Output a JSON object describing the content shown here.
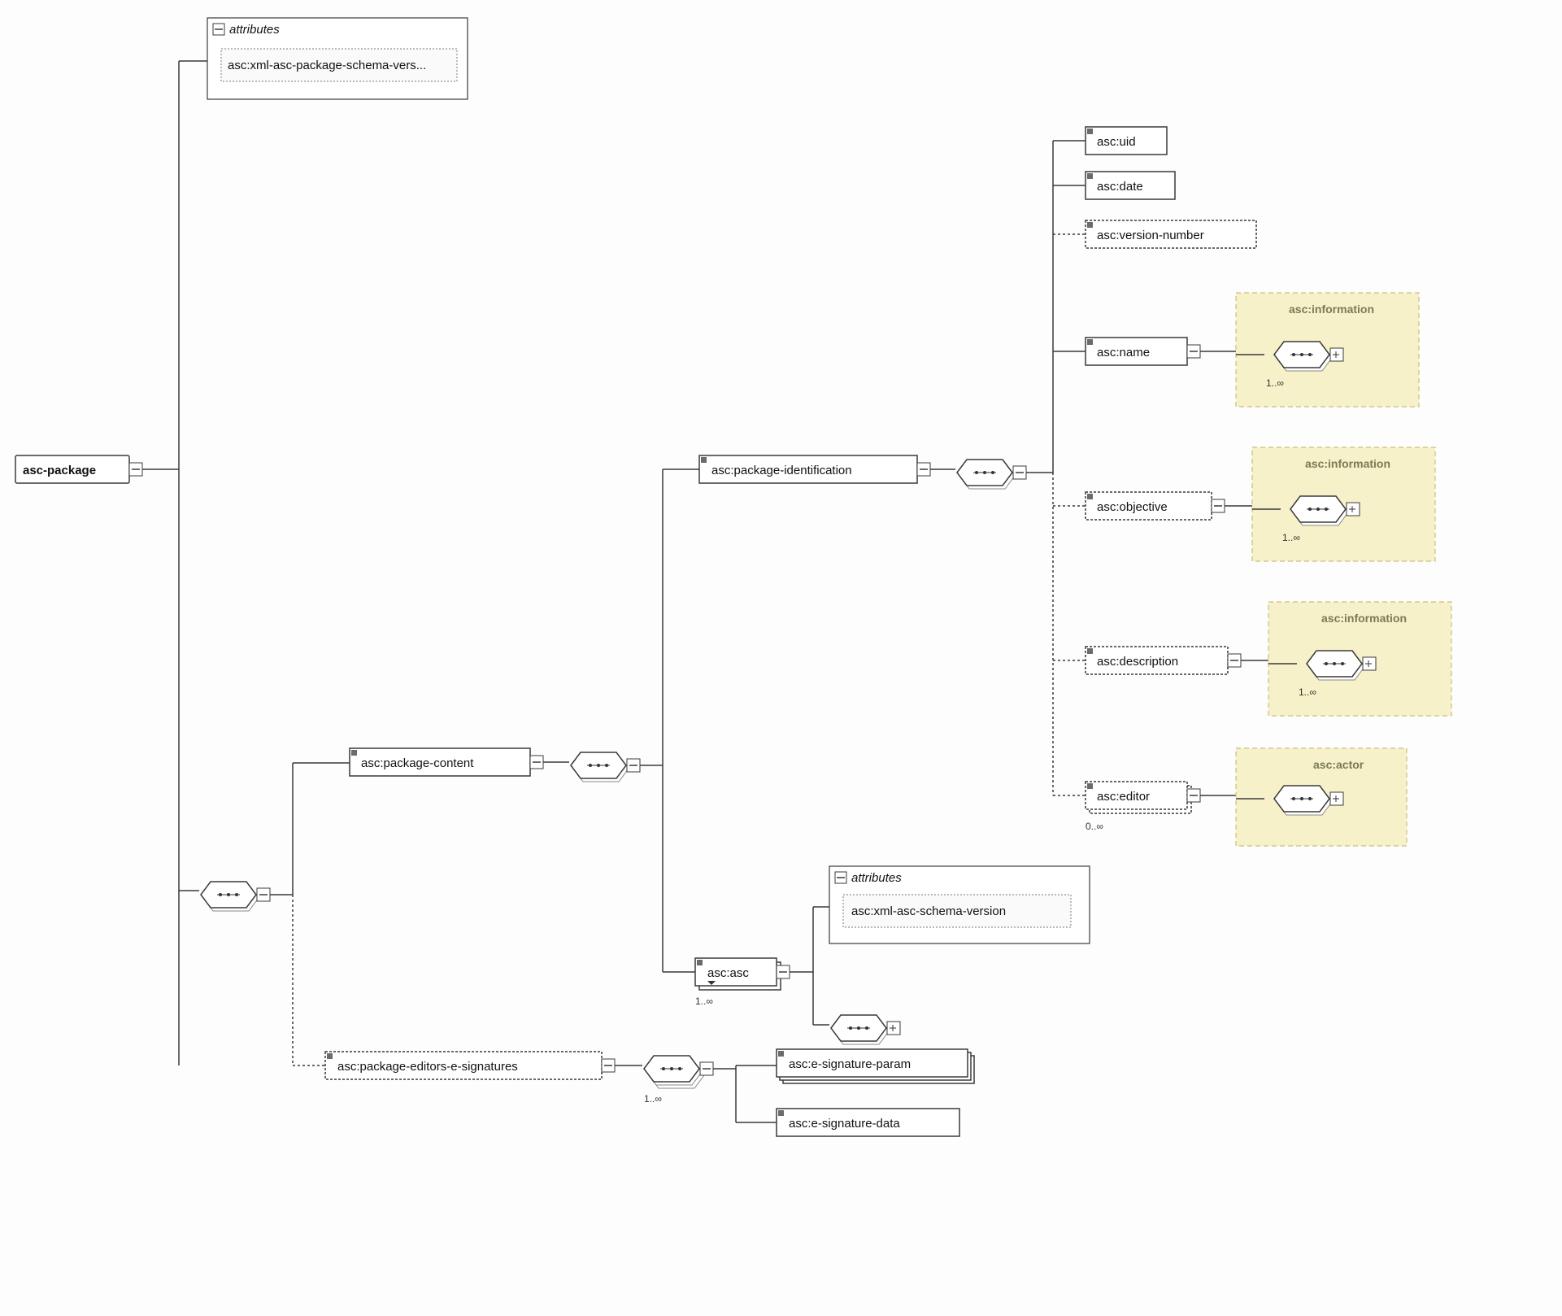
{
  "root": {
    "label": "asc-package"
  },
  "rootAttributes": {
    "title": "attributes",
    "item": "xml-asc-package-schema-vers..."
  },
  "prefix": "asc:",
  "packageContent": {
    "label": "package-content"
  },
  "packageEditorsSig": {
    "label": "package-editors-e-signatures"
  },
  "packageId": {
    "label": "package-identification"
  },
  "ascAsc": {
    "label": "asc",
    "card": "1..∞",
    "attrTitle": "attributes",
    "attrItem": "xml-asc-schema-version"
  },
  "esig": {
    "param": "e-signature-param",
    "data": "e-signature-data",
    "card": "1..∞"
  },
  "idChildren": {
    "uid": "uid",
    "date": "date",
    "version": "version-number",
    "name": "name",
    "objective": "objective",
    "description": "description",
    "editor": "editor"
  },
  "refs": {
    "information": "asc:information",
    "actor": "asc:actor",
    "card1inf": "1..∞",
    "card0inf": "0..∞"
  }
}
